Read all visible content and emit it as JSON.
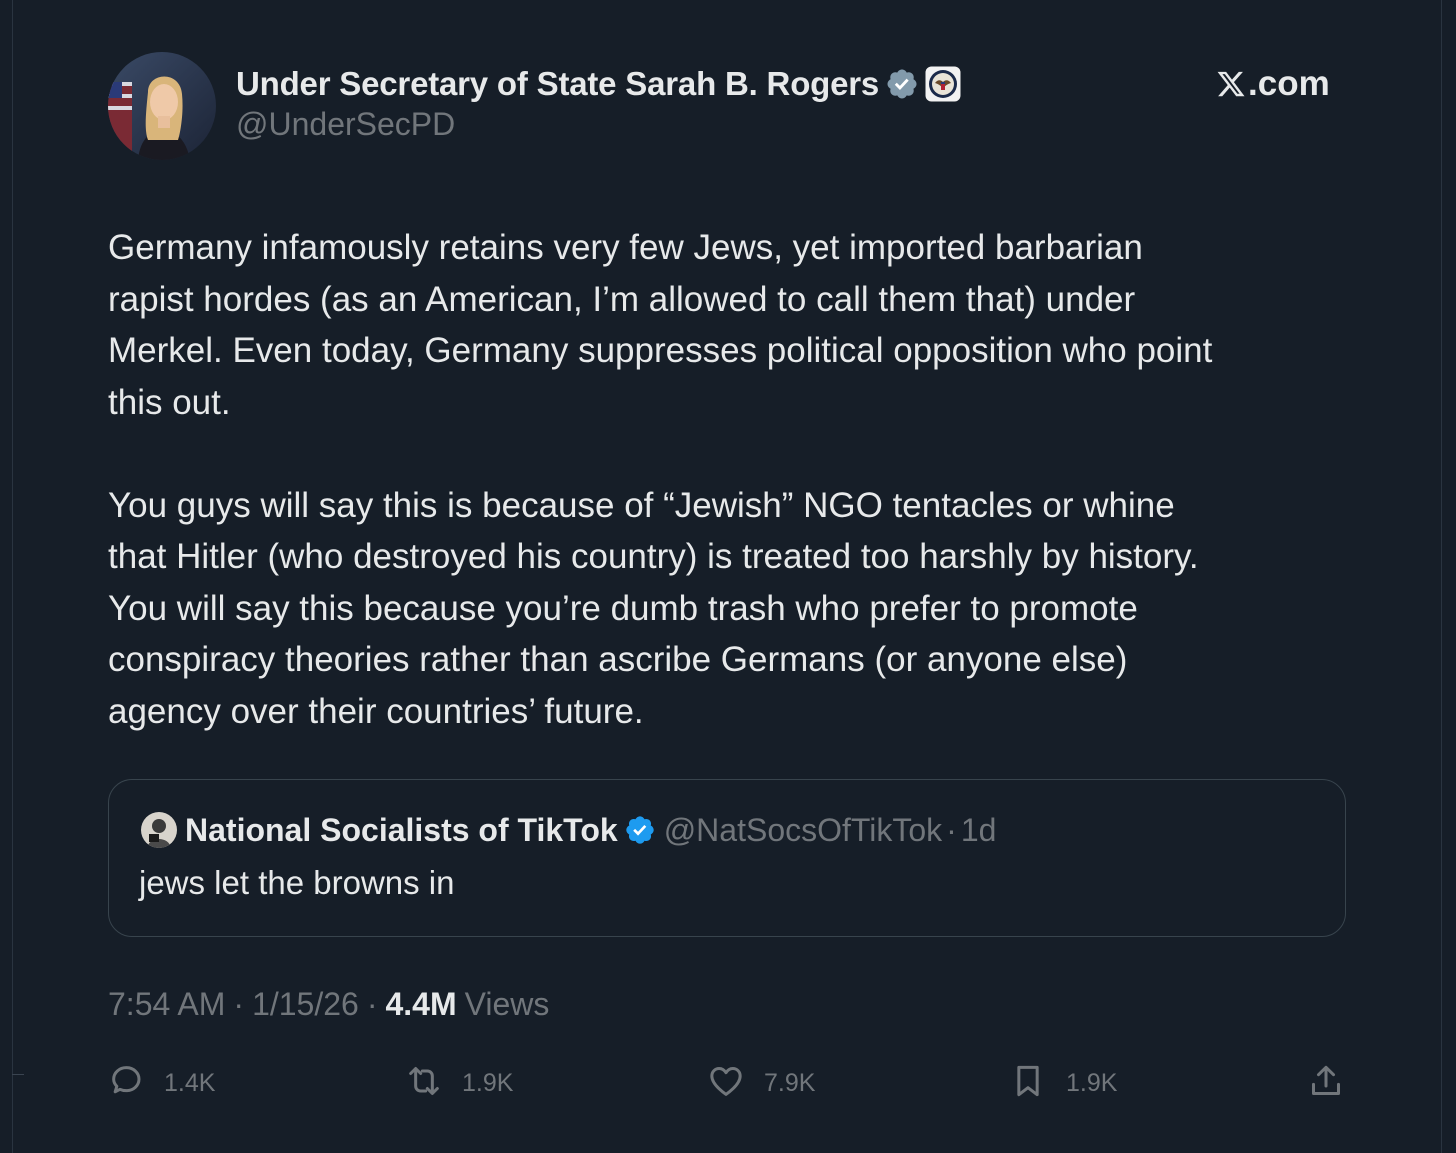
{
  "author": {
    "display_name": "Under Secretary of State Sarah B. Rogers",
    "handle": "@UnderSecPD",
    "avatar_icon": "profile-photo",
    "badges": [
      "gray-verified-badge-icon",
      "government-seal-icon"
    ]
  },
  "brand": {
    "domain_label": ".com",
    "logo_icon": "x-logo-icon"
  },
  "post": {
    "paragraph_1": "Germany infamously retains very few Jews, yet imported barbarian\nrapist hordes (as an American, I’m allowed to call them that) under\nMerkel.  Even today, Germany suppresses political opposition who point\nthis out.",
    "paragraph_2": "You guys will say this is because of “Jewish” NGO tentacles or whine\nthat Hitler (who destroyed his country) is treated too harshly by history.\nYou will say this because you’re dumb trash who prefer to promote\nconspiracy theories rather than ascribe Germans (or anyone else)\nagency over their countries’ future."
  },
  "quoted_post": {
    "display_name": "National Socialists of TikTok",
    "handle": "@NatSocsOfTikTok",
    "separator": "·",
    "time": "1d",
    "text": "jews let the browns in"
  },
  "meta": {
    "time": "7:54 AM",
    "date": "1/15/26",
    "separator": "·",
    "views_count": "4.4M",
    "views_label": "Views"
  },
  "actions": {
    "replies": "1.4K",
    "reposts": "1.9K",
    "likes": "7.9K",
    "bookmarks": "1.9K"
  },
  "colors": {
    "background": "#161e28",
    "text_primary": "#e7e9ea",
    "text_secondary": "#71767b",
    "verified_blue": "#1d9bf0",
    "verified_gray": "#829aab",
    "card_border": "#38444d"
  }
}
